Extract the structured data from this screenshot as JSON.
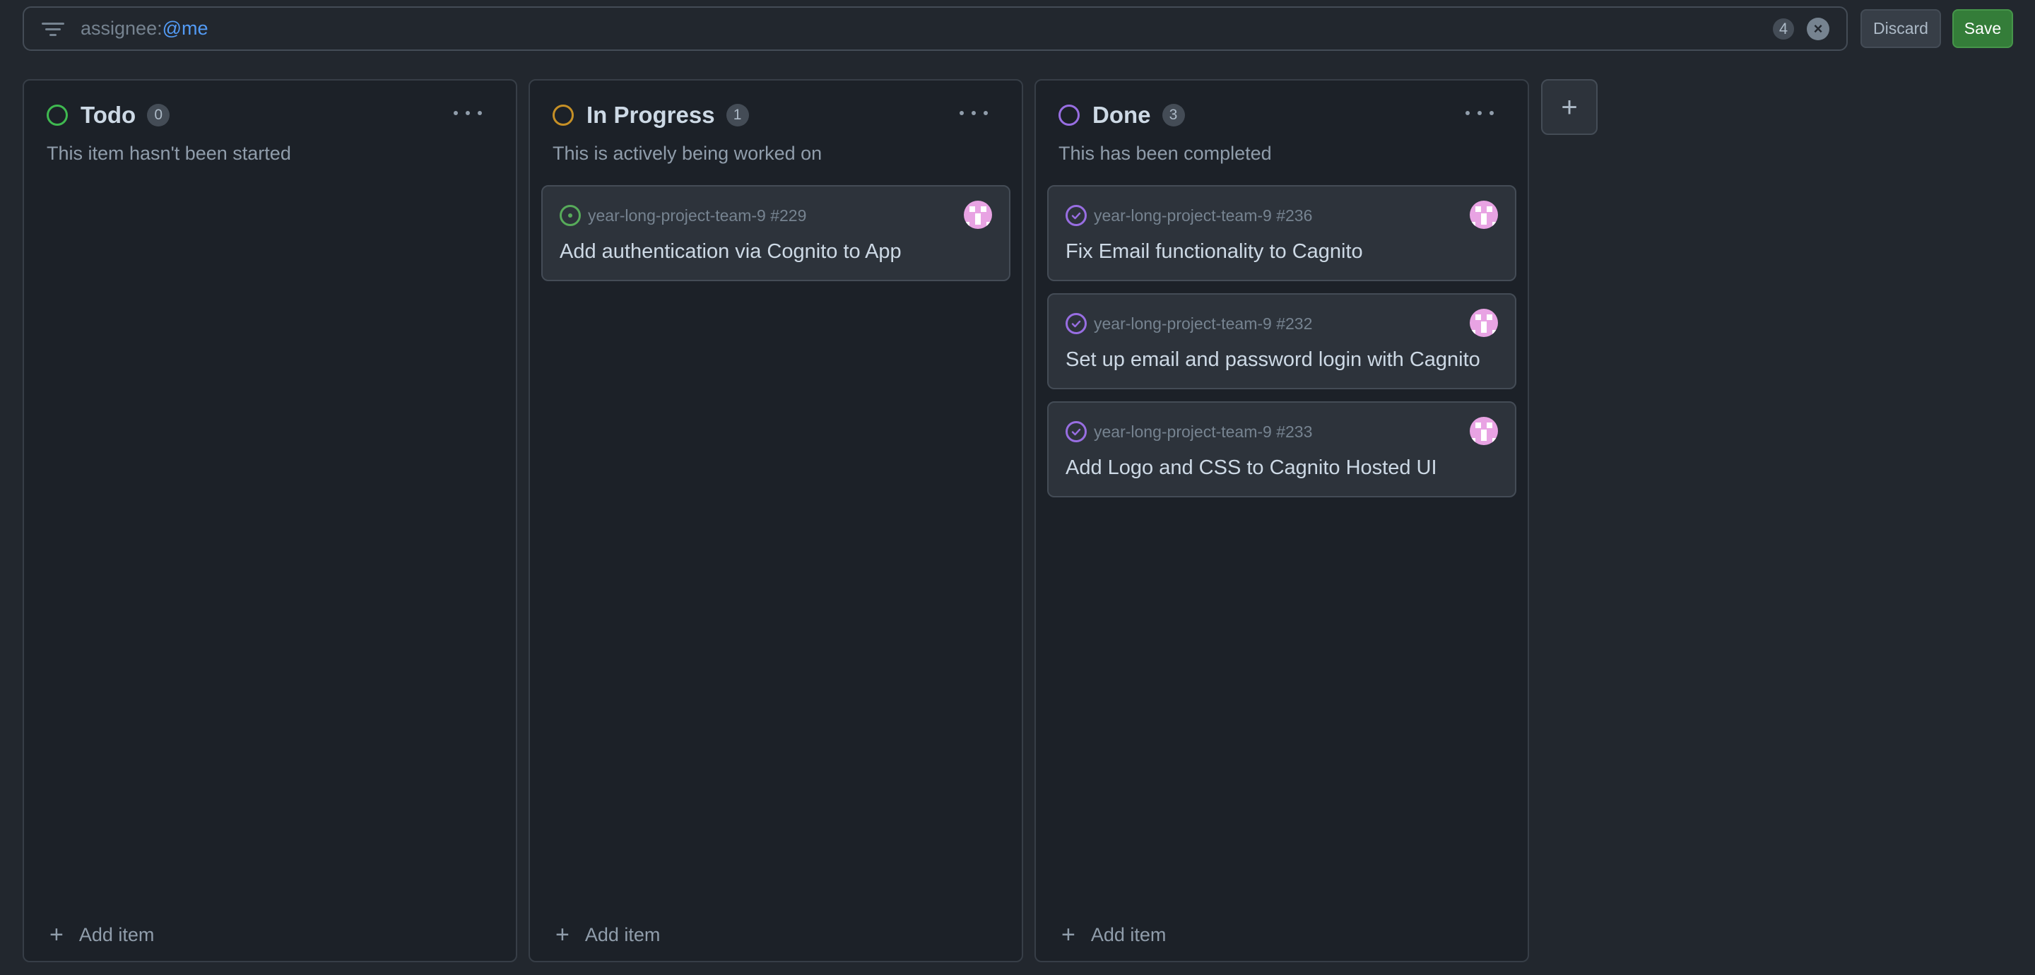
{
  "filter": {
    "key": "assignee:",
    "value": "@me",
    "count": "4"
  },
  "buttons": {
    "discard": "Discard",
    "save": "Save",
    "add_column": "+"
  },
  "colors": {
    "todo": "#3fb950",
    "in_progress": "#c69026",
    "done": "#986ee2",
    "save_bg": "#347d39",
    "link": "#539bf5"
  },
  "columns": [
    {
      "title": "Todo",
      "count": "0",
      "description": "This item hasn't been started",
      "add_label": "Add item",
      "cards": []
    },
    {
      "title": "In Progress",
      "count": "1",
      "description": "This is actively being worked on",
      "add_label": "Add item",
      "cards": [
        {
          "repo": "year-long-project-team-9 #229",
          "title": "Add authentication via Cognito to App",
          "state": "open"
        }
      ]
    },
    {
      "title": "Done",
      "count": "3",
      "description": "This has been completed",
      "add_label": "Add item",
      "cards": [
        {
          "repo": "year-long-project-team-9 #236",
          "title": "Fix Email functionality to Cagnito",
          "state": "closed"
        },
        {
          "repo": "year-long-project-team-9 #232",
          "title": "Set up email and password login with Cagnito",
          "state": "closed"
        },
        {
          "repo": "year-long-project-team-9 #233",
          "title": "Add Logo and CSS to Cagnito Hosted UI",
          "state": "closed"
        }
      ]
    }
  ]
}
